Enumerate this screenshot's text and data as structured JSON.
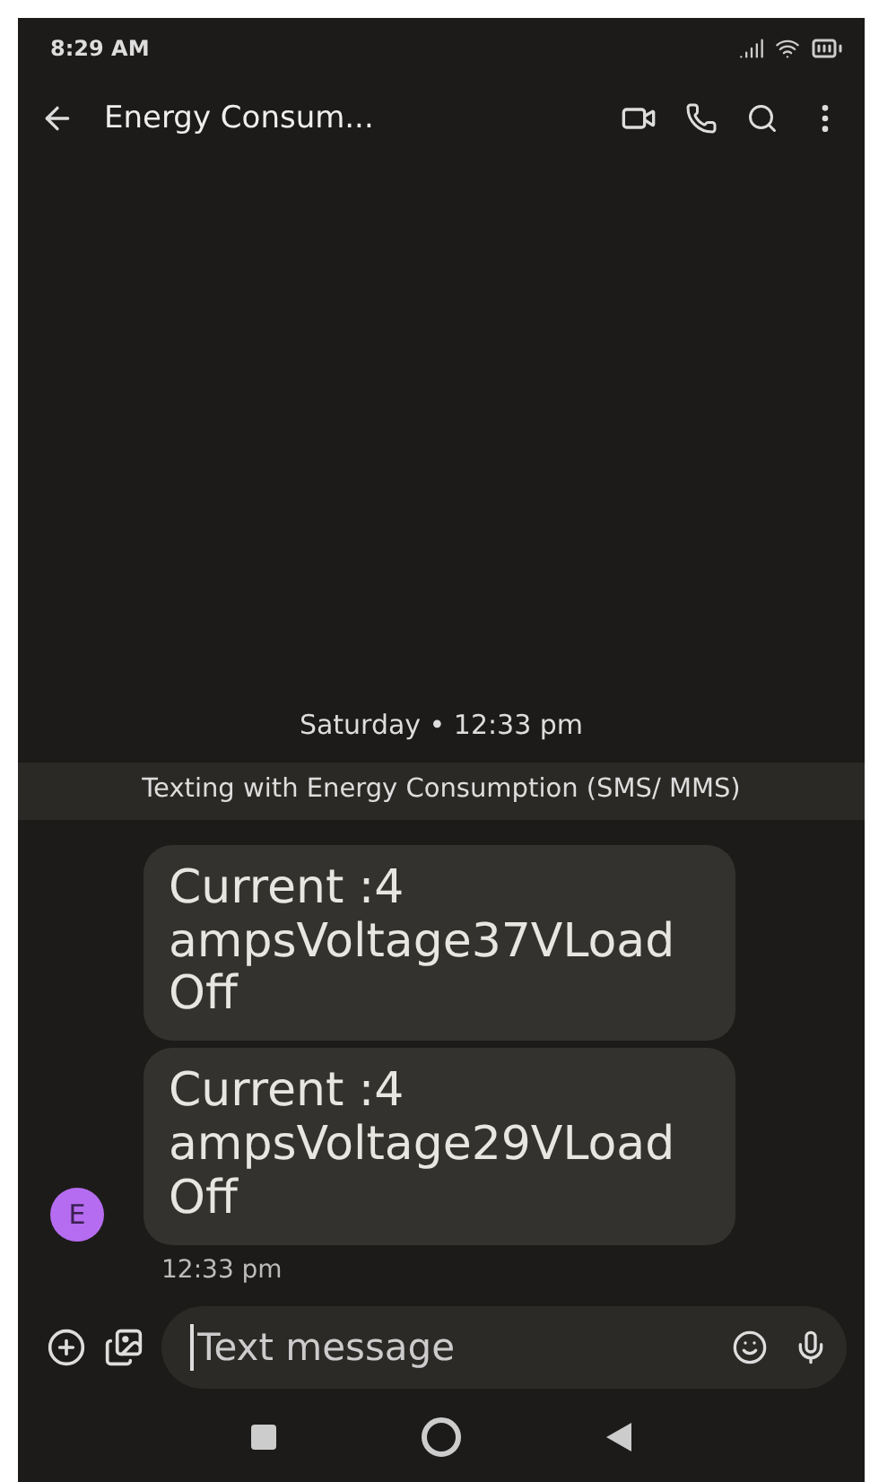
{
  "status_bar": {
    "time": "8:29 AM"
  },
  "header": {
    "title": "Energy Consum..."
  },
  "date_divider": "Saturday • 12:33 pm",
  "banner": "Texting with Energy Consumption (SMS/ MMS)",
  "sender": {
    "initial": "E",
    "color": "#b56cf0"
  },
  "messages": [
    {
      "text": "Current :4 ampsVoltage37VLoad Off"
    },
    {
      "text": "Current :4 ampsVoltage29VLoad Off"
    }
  ],
  "timestamp": "12:33 pm",
  "composer": {
    "placeholder": "Text message"
  }
}
